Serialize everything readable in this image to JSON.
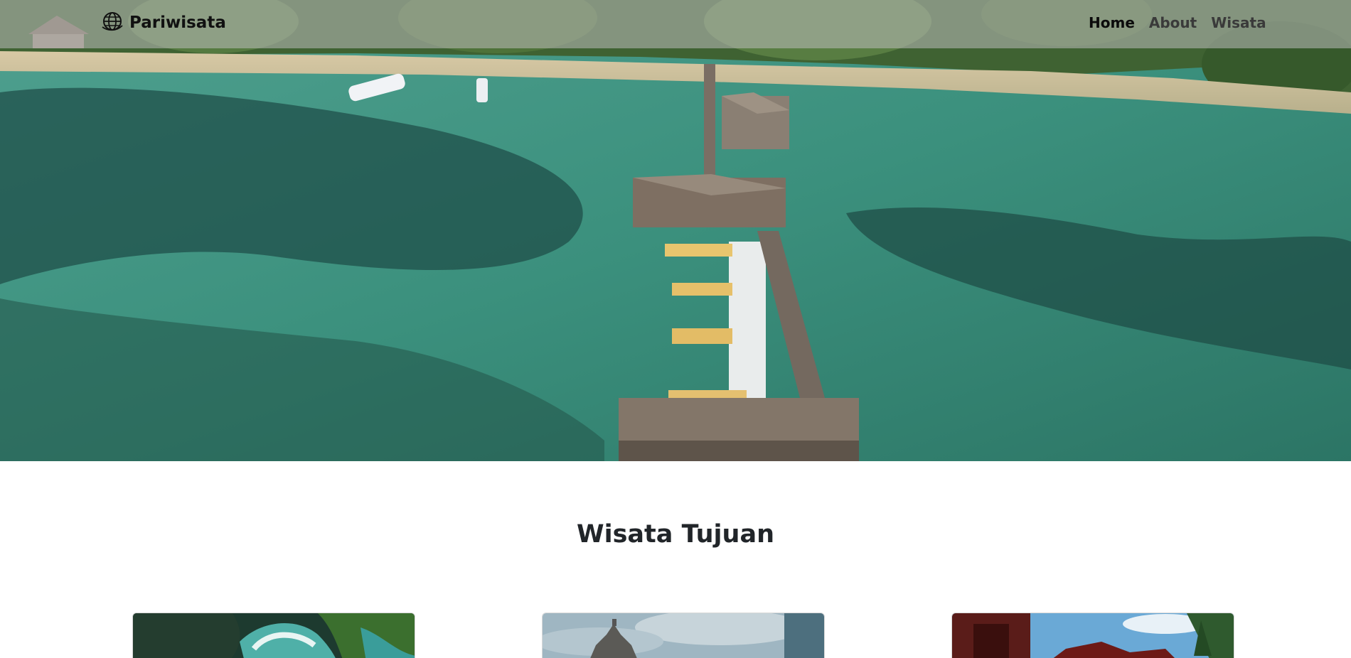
{
  "navbar": {
    "brand": "Pariwisata",
    "brand_icon": "globe-icon",
    "links": [
      {
        "label": "Home",
        "active": true
      },
      {
        "label": "About",
        "active": false
      },
      {
        "label": "Wisata",
        "active": false
      }
    ]
  },
  "hero": {
    "image": "aerial-view-pier-over-turquoise-sea"
  },
  "section": {
    "title": "Wisata Tujuan"
  },
  "cards": [
    {
      "image": "aerial-coastal-cliffs-with-waves"
    },
    {
      "image": "temple-stupa-under-cloudy-sky"
    },
    {
      "image": "traditional-batak-house-with-trees"
    }
  ],
  "colors": {
    "navbar_bg": "#bebebe",
    "sea": "#3b8f7d",
    "text_dark": "#212529"
  }
}
